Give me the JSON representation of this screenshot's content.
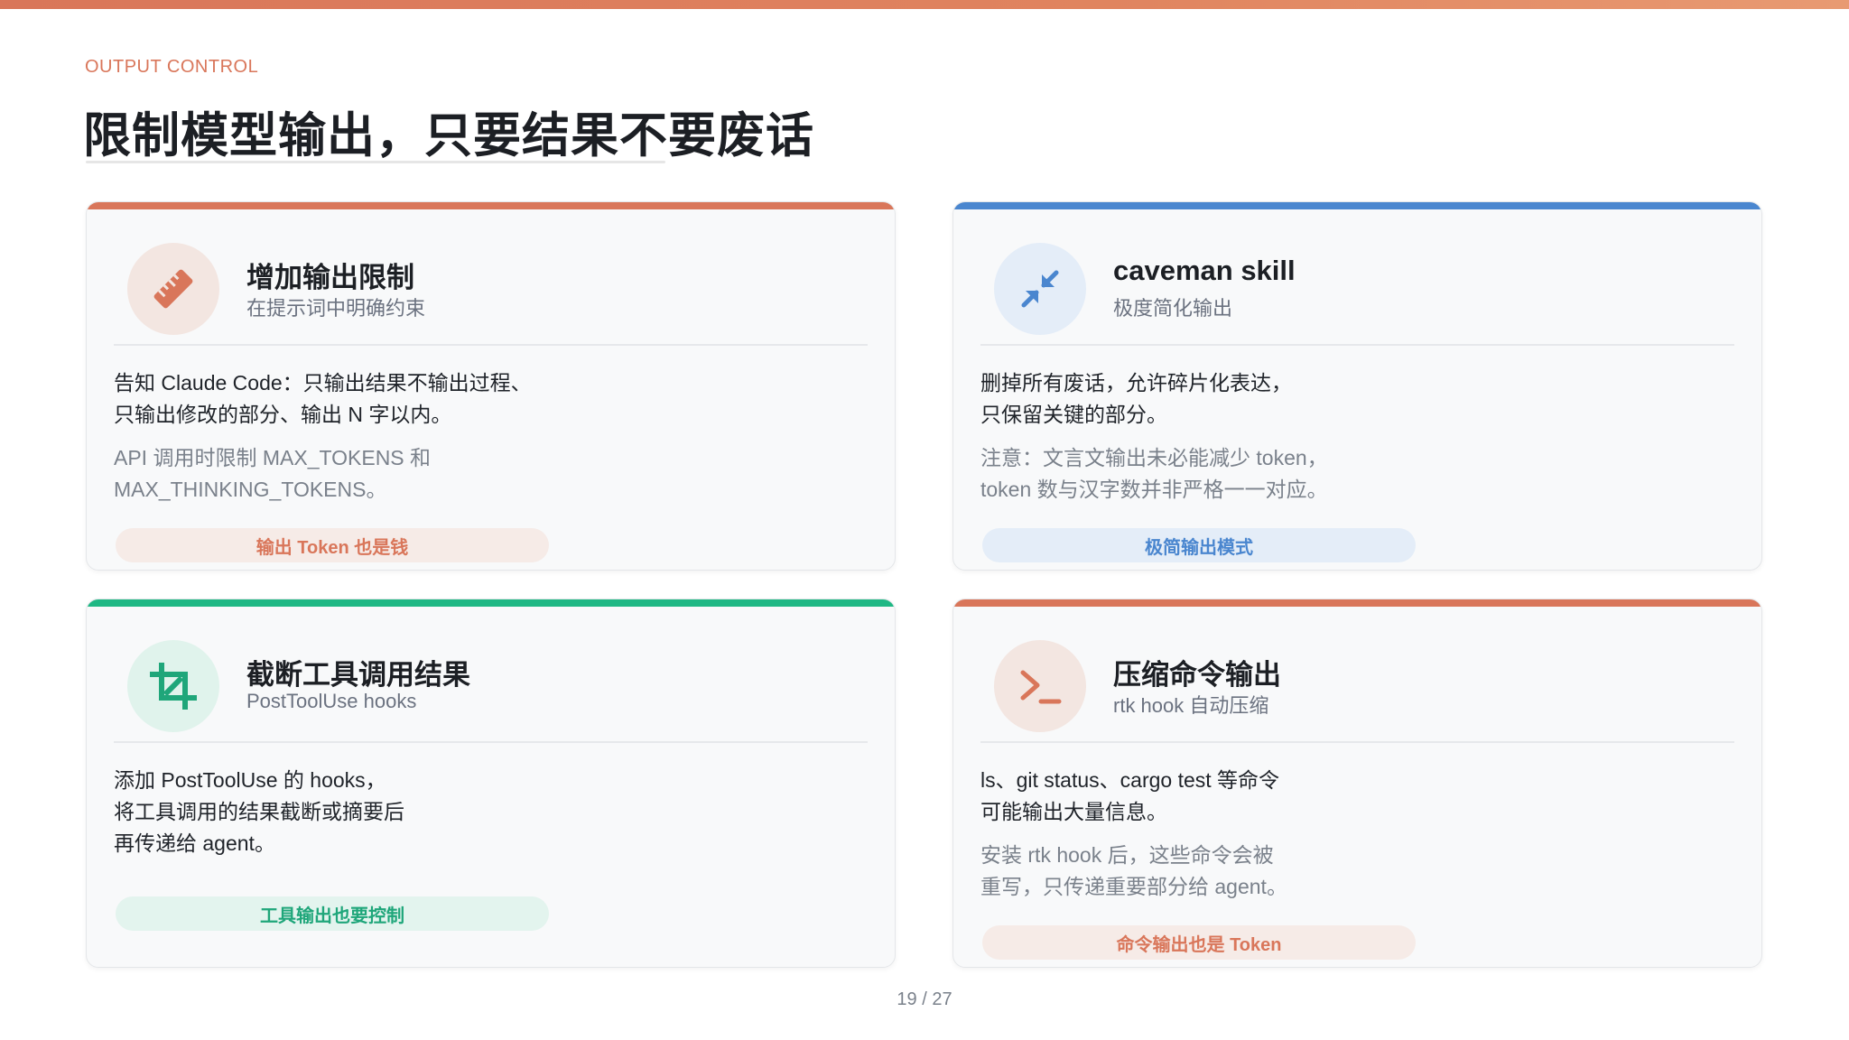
{
  "header": {
    "eyebrow": "OUTPUT CONTROL",
    "title": "限制模型输出，只要结果不要废话"
  },
  "colors": {
    "orange": "#d9765a",
    "blue": "#4a86cf",
    "green": "#1fb884"
  },
  "cards": [
    {
      "icon": "ruler-icon",
      "title": "增加输出限制",
      "subtitle": "在提示词中明确约束",
      "body": [
        "告知 Claude Code：只输出结果不输出过程、",
        "只输出修改的部分、输出 N 字以内。"
      ],
      "note": [
        "API 调用时限制 MAX_TOKENS 和",
        "MAX_THINKING_TOKENS。"
      ],
      "pill": "输出 Token 也是钱"
    },
    {
      "icon": "compress-arrows-icon",
      "title": "caveman skill",
      "subtitle": "极度简化输出",
      "body": [
        "删掉所有废话，允许碎片化表达，",
        "只保留关键的部分。"
      ],
      "note": [
        "注意：文言文输出未必能减少 token，",
        "token 数与汉字数并非严格一一对应。"
      ],
      "pill": "极简输出模式"
    },
    {
      "icon": "crop-icon",
      "title": "截断工具调用结果",
      "subtitle": "PostToolUse hooks",
      "body": [
        "添加 PostToolUse 的 hooks，",
        "将工具调用的结果截断或摘要后",
        "再传递给 agent。"
      ],
      "note": [],
      "pill": "工具输出也要控制"
    },
    {
      "icon": "terminal-prompt-icon",
      "title": "压缩命令输出",
      "subtitle": "rtk hook 自动压缩",
      "body": [
        "ls、git status、cargo test 等命令",
        "可能输出大量信息。"
      ],
      "note": [
        "安装 rtk hook 后，这些命令会被",
        "重写，只传递重要部分给 agent。"
      ],
      "pill": "命令输出也是 Token"
    }
  ],
  "footer": {
    "page_number": "19 / 27"
  }
}
